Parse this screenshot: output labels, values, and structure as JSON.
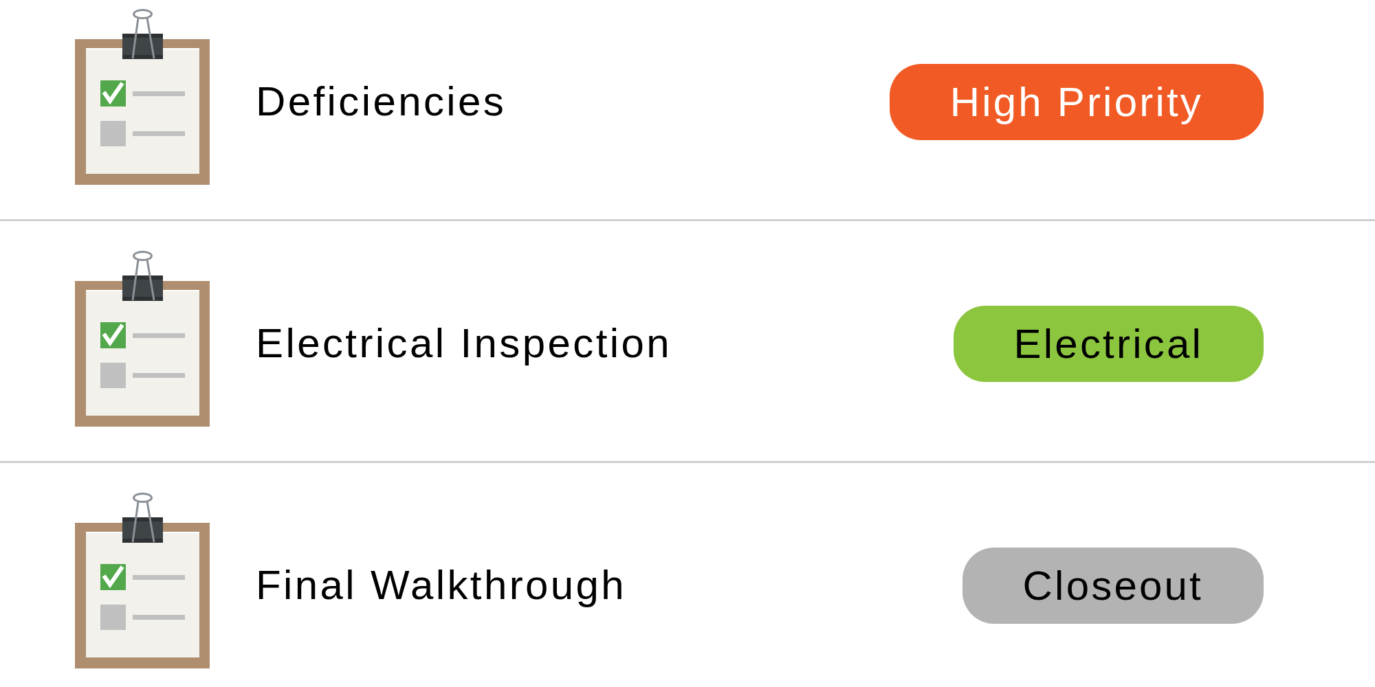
{
  "list": {
    "items": [
      {
        "title": "Deficiencies",
        "tag": {
          "label": "High Priority",
          "color": "#f15a24"
        }
      },
      {
        "title": "Electrical Inspection",
        "tag": {
          "label": "Electrical",
          "color": "#8cc63f"
        }
      },
      {
        "title": "Final Walkthrough",
        "tag": {
          "label": "Closeout",
          "color": "#b3b3b3"
        }
      }
    ]
  }
}
